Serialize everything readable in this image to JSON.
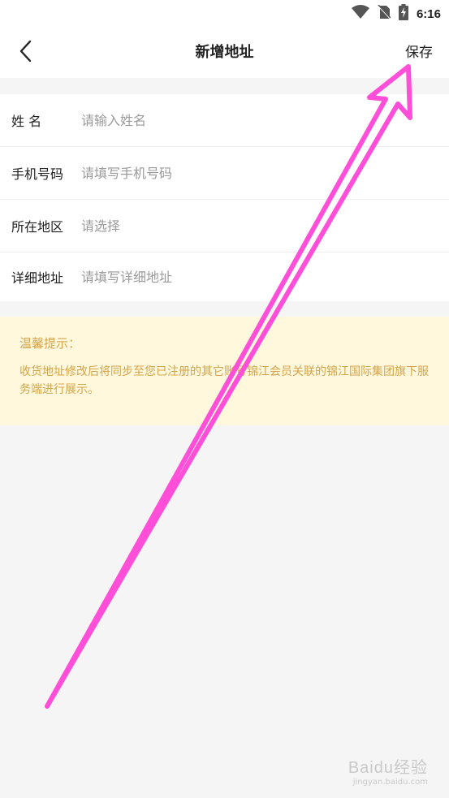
{
  "status_bar": {
    "time": "6:16"
  },
  "nav": {
    "title": "新增地址",
    "save_label": "保存"
  },
  "form": {
    "fields": [
      {
        "label": "姓 名",
        "placeholder": "请输入姓名"
      },
      {
        "label": "手机号码",
        "placeholder": "请填写手机号码"
      },
      {
        "label": "所在地区",
        "placeholder": "请选择"
      },
      {
        "label": "详细地址",
        "placeholder": "请填写详细地址"
      }
    ]
  },
  "tip": {
    "title": "温馨提示：",
    "text": "收货地址修改后将同步至您已注册的其它账号锦江会员关联的锦江国际集团旗下服务端进行展示。"
  },
  "watermark": {
    "logo": "Baidu经验",
    "sub": "jingyan.baidu.com"
  },
  "colors": {
    "tip_bg": "#fff8dd",
    "tip_text": "#d4a44a",
    "annotation_arrow": "#ff4fd8"
  }
}
